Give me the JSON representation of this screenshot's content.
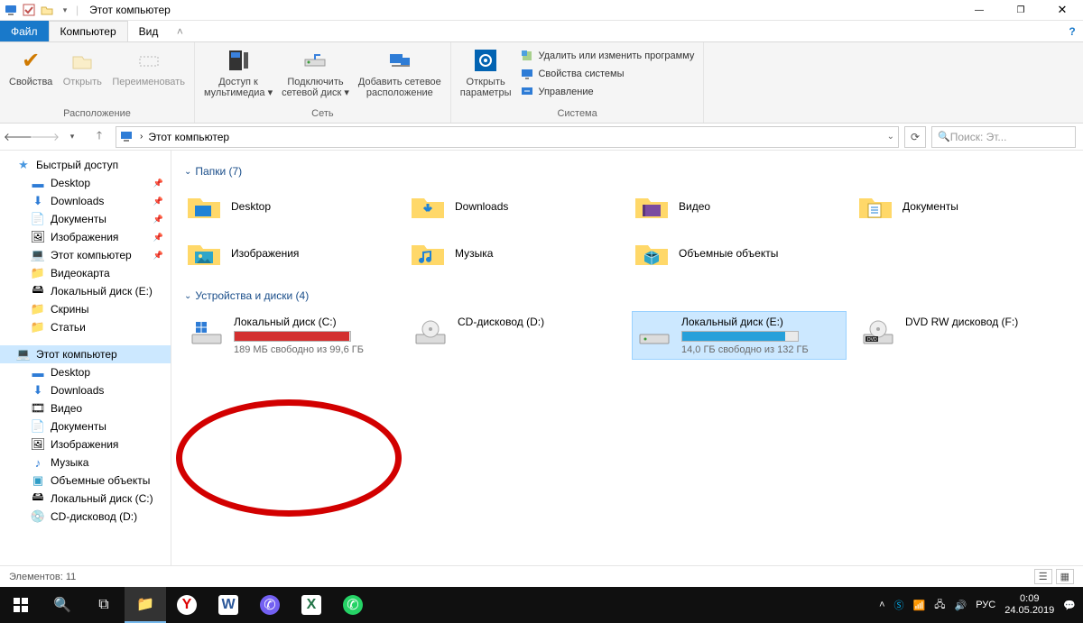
{
  "window": {
    "title": "Этот компьютер",
    "min": "—",
    "max": "▢",
    "close": "✕"
  },
  "menubar": {
    "file": "Файл",
    "computer": "Компьютер",
    "view": "Вид"
  },
  "ribbon": {
    "group_location": "Расположение",
    "group_network": "Сеть",
    "group_system": "Система",
    "properties": "Свойства",
    "open": "Открыть",
    "rename": "Переименовать",
    "media_access_l1": "Доступ к",
    "media_access_l2": "мультимедиа",
    "map_drive_l1": "Подключить",
    "map_drive_l2": "сетевой диск",
    "add_net_l1": "Добавить сетевое",
    "add_net_l2": "расположение",
    "open_params_l1": "Открыть",
    "open_params_l2": "параметры",
    "uninstall": "Удалить или изменить программу",
    "sys_props": "Свойства системы",
    "manage": "Управление"
  },
  "address": {
    "back": "←",
    "fwd": "→",
    "up": "↑",
    "crumb": "Этот компьютер",
    "search_placeholder": "Поиск: Эт..."
  },
  "sidebar": {
    "quick": "Быстрый доступ",
    "desktop": "Desktop",
    "downloads": "Downloads",
    "documents": "Документы",
    "pictures": "Изображения",
    "this_pc_q": "Этот компьютер",
    "videocard": "Видеокарта",
    "local_e": "Локальный диск (E:)",
    "screens": "Скрины",
    "articles": "Статьи",
    "this_pc": "Этот компьютер",
    "desktop2": "Desktop",
    "downloads2": "Downloads",
    "video": "Видео",
    "documents2": "Документы",
    "pictures2": "Изображения",
    "music": "Музыка",
    "objects3d": "Объемные объекты",
    "local_c": "Локальный диск (C:)",
    "cd_d": "CD-дисковод (D:)"
  },
  "content": {
    "section_folders": "Папки (7)",
    "section_drives": "Устройства и диски (4)",
    "folders": {
      "desktop": "Desktop",
      "downloads": "Downloads",
      "video": "Видео",
      "documents": "Документы",
      "pictures": "Изображения",
      "music": "Музыка",
      "objects3d": "Объемные объекты"
    },
    "drives": {
      "c": {
        "name": "Локальный диск (C:)",
        "sub": "189 МБ свободно из 99,6 ГБ",
        "fill_pct": 99
      },
      "d": {
        "name": "CD-дисковод (D:)"
      },
      "e": {
        "name": "Локальный диск (E:)",
        "sub": "14,0 ГБ свободно из 132 ГБ",
        "fill_pct": 89
      },
      "f": {
        "name": "DVD RW дисковод (F:)"
      }
    }
  },
  "statusbar": {
    "items": "Элементов: 11"
  },
  "taskbar": {
    "lang": "РУС",
    "time": "0:09",
    "date": "24.05.2019"
  }
}
